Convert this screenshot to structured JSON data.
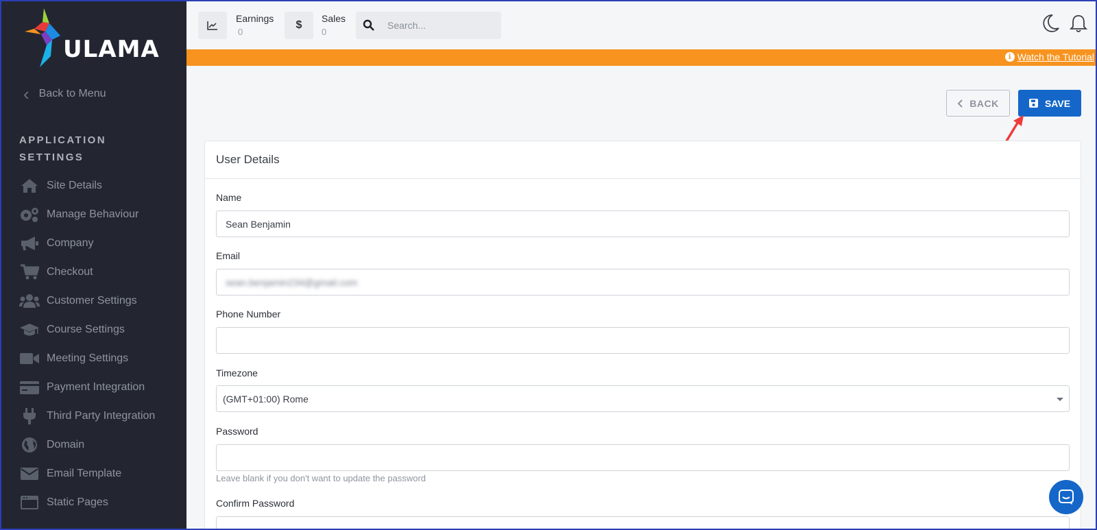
{
  "brand": {
    "name": "ULAMA"
  },
  "sidebar": {
    "back_label": "Back to Menu",
    "section_title_line1": "APPLICATION",
    "section_title_line2": "SETTINGS",
    "items": [
      {
        "label": "Site Details",
        "icon": "home-icon"
      },
      {
        "label": "Manage Behaviour",
        "icon": "gears-icon"
      },
      {
        "label": "Company",
        "icon": "megaphone-icon"
      },
      {
        "label": "Checkout",
        "icon": "cart-icon"
      },
      {
        "label": "Customer Settings",
        "icon": "users-icon"
      },
      {
        "label": "Course Settings",
        "icon": "graduation-cap-icon"
      },
      {
        "label": "Meeting Settings",
        "icon": "video-icon"
      },
      {
        "label": "Payment Integration",
        "icon": "credit-card-icon"
      },
      {
        "label": "Third Party Integration",
        "icon": "plug-icon"
      },
      {
        "label": "Domain",
        "icon": "globe-icon"
      },
      {
        "label": "Email Template",
        "icon": "envelope-icon"
      },
      {
        "label": "Static Pages",
        "icon": "window-icon"
      }
    ]
  },
  "topbar": {
    "earnings_label": "Earnings",
    "earnings_value": "0",
    "sales_label": "Sales",
    "sales_value": "0",
    "sales_icon_glyph": "$",
    "search_placeholder": "Search..."
  },
  "banner": {
    "tutorial_link": "Watch the Tutorial",
    "info_glyph": "i",
    "color": "#f7931e"
  },
  "actions": {
    "back_label": "BACK",
    "save_label": "SAVE",
    "save_color": "#1467c9"
  },
  "form": {
    "title": "User Details",
    "name_label": "Name",
    "name_value": "Sean Benjamin",
    "email_label": "Email",
    "email_value": "sean.benjamin234@gmail.com",
    "phone_label": "Phone Number",
    "phone_value": "",
    "timezone_label": "Timezone",
    "timezone_value": "(GMT+01:00) Rome",
    "password_label": "Password",
    "password_hint": "Leave blank if you don't want to update the password",
    "confirm_password_label": "Confirm Password"
  }
}
